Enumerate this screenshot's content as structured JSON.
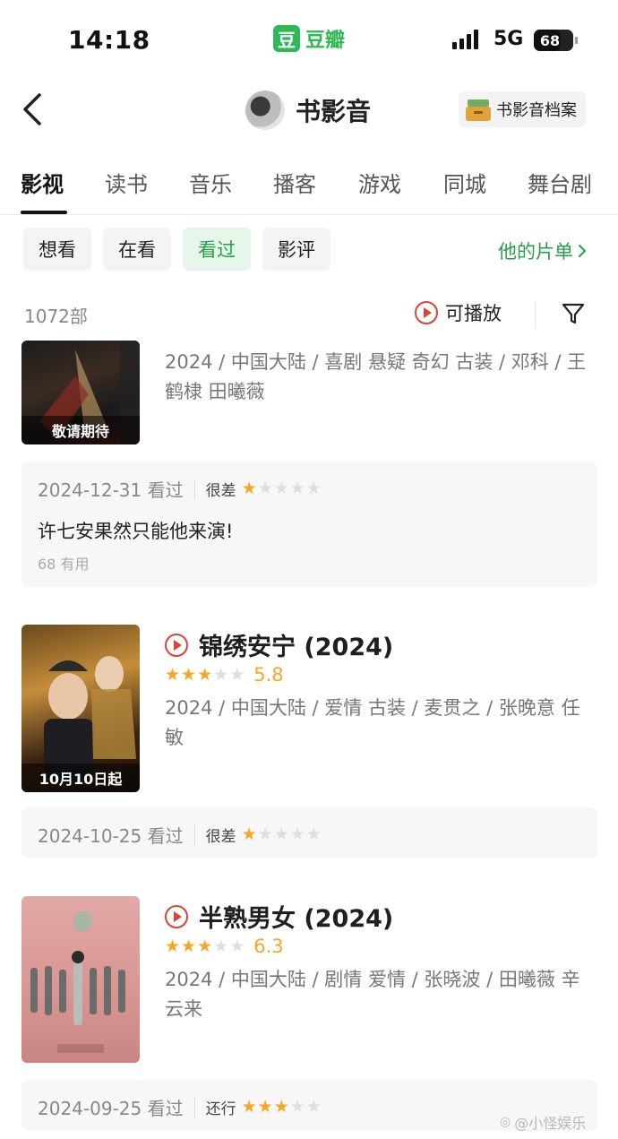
{
  "status_bar": {
    "time": "14:18",
    "app_name": "豆瓣",
    "app_icon_char": "豆",
    "network": "5G",
    "battery": "68",
    "battery_level": 0.68
  },
  "nav": {
    "title": "书影音",
    "archive_label": "书影音档案"
  },
  "tabs": [
    {
      "label": "影视",
      "active": true
    },
    {
      "label": "读书"
    },
    {
      "label": "音乐"
    },
    {
      "label": "播客"
    },
    {
      "label": "游戏"
    },
    {
      "label": "同城"
    },
    {
      "label": "舞台剧"
    }
  ],
  "filters": {
    "chips": [
      {
        "label": "想看"
      },
      {
        "label": "在看"
      },
      {
        "label": "看过",
        "active": true
      },
      {
        "label": "影评"
      }
    ],
    "his_list": "他的片单"
  },
  "list_header": {
    "count": "1072部",
    "playable": "可播放"
  },
  "items": [
    {
      "meta": "2024 / 中国大陆 / 喜剧 悬疑 奇幻 古装 / 邓科 / 王鹤棣 田曦薇",
      "poster_badge": "敬请期待",
      "review": {
        "date": "2024-12-31 看过",
        "level": "很差",
        "stars": 1,
        "text": "许七安果然只能他来演!",
        "useful": "68 有用"
      }
    },
    {
      "title": "锦绣安宁 (2024)",
      "rating_stars": 3,
      "score": "5.8",
      "meta": "2024 / 中国大陆 / 爱情 古装 / 麦贯之 / 张晚意 任敏",
      "poster_badge": "10月10日起",
      "review": {
        "date": "2024-10-25 看过",
        "level": "很差",
        "stars": 1
      }
    },
    {
      "title": "半熟男女 (2024)",
      "rating_stars": 3,
      "score": "6.3",
      "meta": "2024 / 中国大陆 / 剧情 爱情 / 张晓波 / 田曦薇 辛云来",
      "review": {
        "date": "2024-09-25 看过",
        "level": "还行",
        "stars": 3
      }
    }
  ],
  "watermark": "@小怪娱乐",
  "colors": {
    "brand_green": "#2fb956",
    "accent_green": "#2a9d4a",
    "star": "#f5a623",
    "play_red": "#d6453a"
  }
}
